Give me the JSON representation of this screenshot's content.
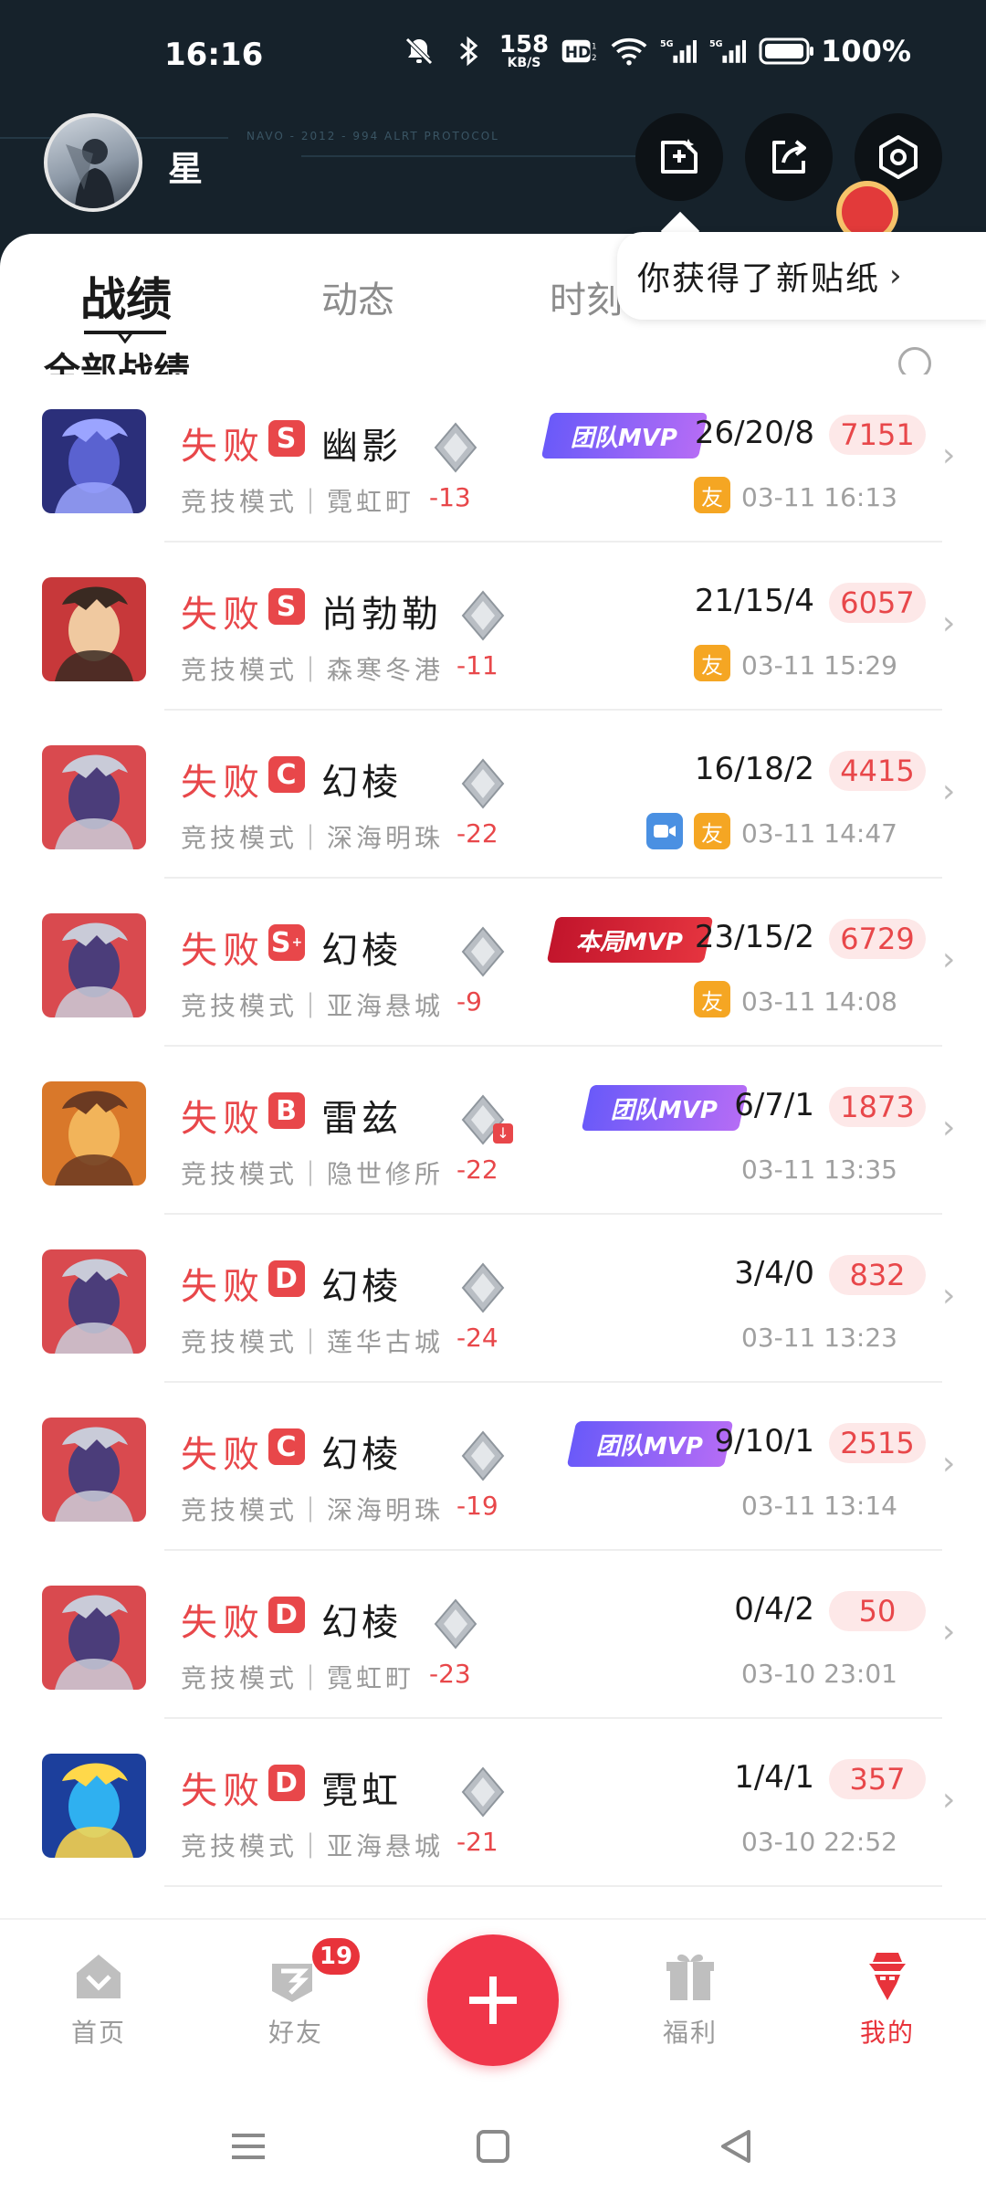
{
  "status_bar": {
    "time": "16:16",
    "speed_value": "158",
    "speed_unit": "KB/S",
    "battery": "100%"
  },
  "header": {
    "username": "星",
    "decor_text": "NAVO - 2012 - 994 ALRT PROTOCOL"
  },
  "tabs": [
    {
      "label": "战绩",
      "active": true
    },
    {
      "label": "动态",
      "active": false
    },
    {
      "label": "时刻",
      "active": false
    }
  ],
  "tooltip": {
    "text": "你获得了新贴纸",
    "chevron": "›"
  },
  "section": {
    "title": "全部战绩"
  },
  "matches": [
    {
      "result": "失败",
      "grade": "S",
      "grade_plus": "",
      "hero": "幽影",
      "mode": "竞技模式｜霓虹町",
      "rank_delta": "-13",
      "mvp": "团队MVP",
      "mvp_type": "team",
      "kda": "26/20/8",
      "score": "7151",
      "time": "03-11 16:13",
      "friend": "友",
      "video": false,
      "rank_down": false
    },
    {
      "result": "失败",
      "grade": "S",
      "grade_plus": "",
      "hero": "尚勃勒",
      "mode": "竞技模式｜森寒冬港",
      "rank_delta": "-11",
      "mvp": "",
      "mvp_type": "",
      "kda": "21/15/4",
      "score": "6057",
      "time": "03-11 15:29",
      "friend": "友",
      "video": false,
      "rank_down": false
    },
    {
      "result": "失败",
      "grade": "C",
      "grade_plus": "",
      "hero": "幻棱",
      "mode": "竞技模式｜深海明珠",
      "rank_delta": "-22",
      "mvp": "",
      "mvp_type": "",
      "kda": "16/18/2",
      "score": "4415",
      "time": "03-11 14:47",
      "friend": "友",
      "video": true,
      "rank_down": false
    },
    {
      "result": "失败",
      "grade": "S",
      "grade_plus": "+",
      "hero": "幻棱",
      "mode": "竞技模式｜亚海悬城",
      "rank_delta": "-9",
      "mvp": "本局MVP",
      "mvp_type": "match",
      "kda": "23/15/2",
      "score": "6729",
      "time": "03-11 14:08",
      "friend": "友",
      "video": false,
      "rank_down": false
    },
    {
      "result": "失败",
      "grade": "B",
      "grade_plus": "",
      "hero": "雷兹",
      "mode": "竞技模式｜隐世修所",
      "rank_delta": "-22",
      "mvp": "团队MVP",
      "mvp_type": "team",
      "kda": "6/7/1",
      "score": "1873",
      "time": "03-11 13:35",
      "friend": "",
      "video": false,
      "rank_down": true
    },
    {
      "result": "失败",
      "grade": "D",
      "grade_plus": "",
      "hero": "幻棱",
      "mode": "竞技模式｜莲华古城",
      "rank_delta": "-24",
      "mvp": "",
      "mvp_type": "",
      "kda": "3/4/0",
      "score": "832",
      "time": "03-11 13:23",
      "friend": "",
      "video": false,
      "rank_down": false
    },
    {
      "result": "失败",
      "grade": "C",
      "grade_plus": "",
      "hero": "幻棱",
      "mode": "竞技模式｜深海明珠",
      "rank_delta": "-19",
      "mvp": "团队MVP",
      "mvp_type": "team",
      "kda": "9/10/1",
      "score": "2515",
      "time": "03-11 13:14",
      "friend": "",
      "video": false,
      "rank_down": false
    },
    {
      "result": "失败",
      "grade": "D",
      "grade_plus": "",
      "hero": "幻棱",
      "mode": "竞技模式｜霓虹町",
      "rank_delta": "-23",
      "mvp": "",
      "mvp_type": "",
      "kda": "0/4/2",
      "score": "50",
      "time": "03-10 23:01",
      "friend": "",
      "video": false,
      "rank_down": false
    },
    {
      "result": "失败",
      "grade": "D",
      "grade_plus": "",
      "hero": "霓虹",
      "mode": "竞技模式｜亚海悬城",
      "rank_delta": "-21",
      "mvp": "",
      "mvp_type": "",
      "kda": "1/4/1",
      "score": "357",
      "time": "03-10 22:52",
      "friend": "",
      "video": false,
      "rank_down": false
    }
  ],
  "bottom_nav": {
    "items": [
      {
        "label": "首页",
        "icon": "home-icon"
      },
      {
        "label": "好友",
        "icon": "friends-icon"
      },
      {
        "label": "福利",
        "icon": "gift-icon"
      },
      {
        "label": "我的",
        "icon": "profile-icon"
      }
    ],
    "friends_badge": "19"
  },
  "colors": {
    "accent": "#e8474a",
    "header_bg": "#16222b",
    "fab": "#f0364a",
    "team_mvp": "#7b5cf8",
    "match_mvp": "#d0202f",
    "friend_chip": "#f5a623",
    "video_chip": "#4a90e2"
  }
}
